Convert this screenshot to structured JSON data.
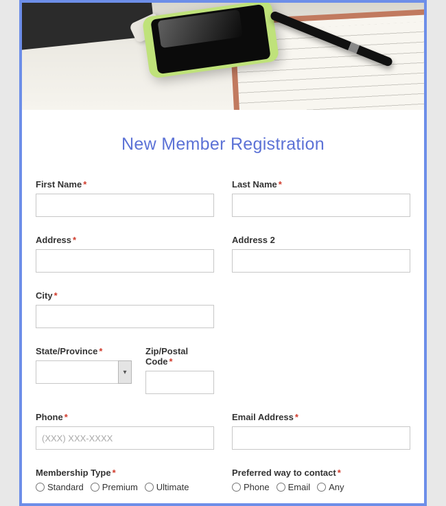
{
  "title": "New Member Registration",
  "fields": {
    "first_name": {
      "label": "First Name",
      "required": true,
      "value": ""
    },
    "last_name": {
      "label": "Last Name",
      "required": true,
      "value": ""
    },
    "address": {
      "label": "Address",
      "required": true,
      "value": ""
    },
    "address2": {
      "label": "Address 2",
      "required": false,
      "value": ""
    },
    "city": {
      "label": "City",
      "required": true,
      "value": ""
    },
    "state": {
      "label": "State/Province",
      "required": true,
      "value": ""
    },
    "zip": {
      "label": "Zip/Postal Code",
      "required": true,
      "value": ""
    },
    "phone": {
      "label": "Phone",
      "required": true,
      "value": "",
      "placeholder": "(XXX) XXX-XXXX"
    },
    "email": {
      "label": "Email Address",
      "required": true,
      "value": ""
    }
  },
  "required_mark": "*",
  "membership": {
    "label": "Membership Type",
    "required": true,
    "options": [
      "Standard",
      "Premium",
      "Ultimate"
    ]
  },
  "contact_pref": {
    "label": "Preferred way to contact",
    "required": true,
    "options": [
      "Phone",
      "Email",
      "Any"
    ]
  }
}
